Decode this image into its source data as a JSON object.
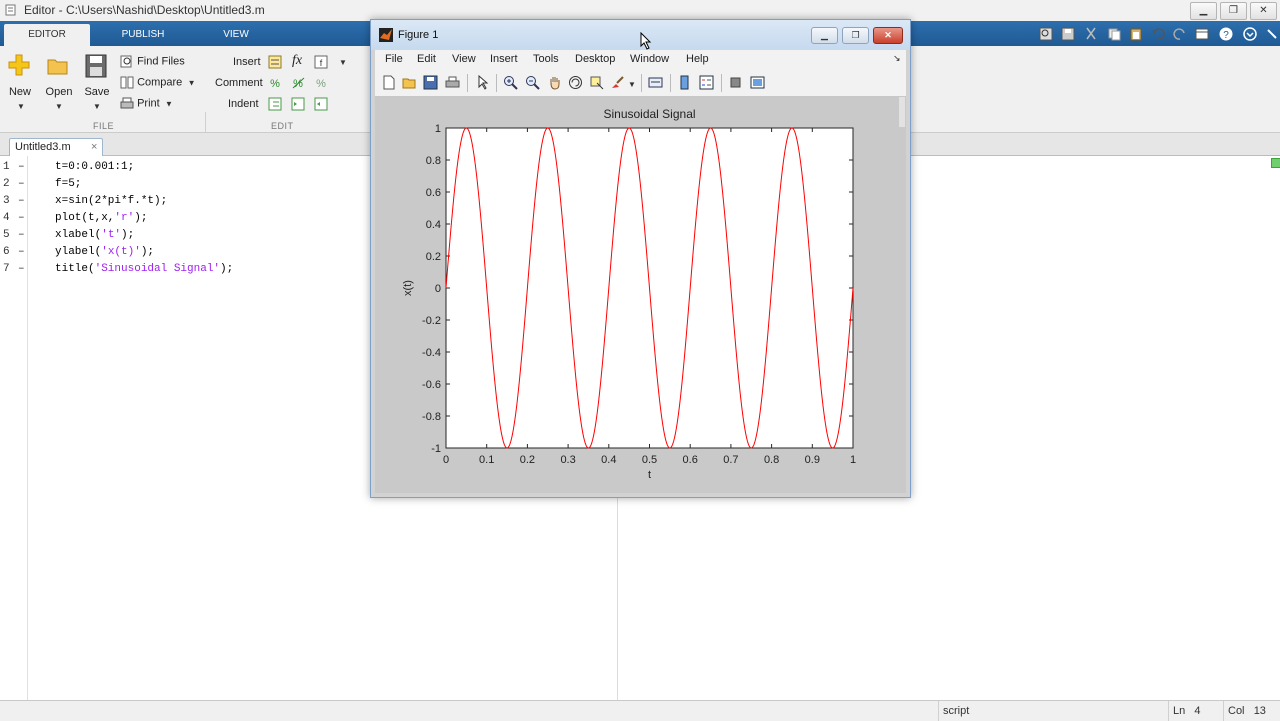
{
  "window": {
    "title": "Editor - C:\\Users\\Nashid\\Desktop\\Untitled3.m"
  },
  "ribbon": {
    "tabs": [
      "EDITOR",
      "PUBLISH",
      "VIEW"
    ],
    "file": {
      "new": "New",
      "open": "Open",
      "save": "Save",
      "find_files": "Find Files",
      "compare": "Compare",
      "print": "Print",
      "section_label": "FILE"
    },
    "edit": {
      "insert": "Insert",
      "fx": "fx",
      "comment": "Comment",
      "indent": "Indent",
      "section_label": "EDIT"
    }
  },
  "doc_tab": {
    "name": "Untitled3.m",
    "close": "×"
  },
  "editor": {
    "lines": [
      {
        "num": "1",
        "code": "t=0:0.001:1;",
        "str": ""
      },
      {
        "num": "2",
        "code": "f=5;",
        "str": ""
      },
      {
        "num": "3",
        "code": "x=sin(2*pi*f.*t);",
        "str": ""
      },
      {
        "num": "4",
        "code": "plot(t,x,",
        "str": "'r'",
        "tail": ");"
      },
      {
        "num": "5",
        "code": "xlabel(",
        "str": "'t'",
        "tail": ");"
      },
      {
        "num": "6",
        "code": "ylabel(",
        "str": "'x(t)'",
        "tail": ");"
      },
      {
        "num": "7",
        "code": "title(",
        "str": "'Sinusoidal Signal'",
        "tail": ");"
      }
    ],
    "dash": "–"
  },
  "status": {
    "mode": "script",
    "ln_label": "Ln",
    "ln_value": "4",
    "col_label": "Col",
    "col_value": "13"
  },
  "figure": {
    "title": "Figure 1",
    "menu": [
      "File",
      "Edit",
      "View",
      "Insert",
      "Tools",
      "Desktop",
      "Window",
      "Help"
    ]
  },
  "chart_data": {
    "type": "line",
    "title": "Sinusoidal Signal",
    "xlabel": "t",
    "ylabel": "x(t)",
    "xlim": [
      0,
      1
    ],
    "ylim": [
      -1,
      1
    ],
    "xticks": [
      "0",
      "0.1",
      "0.2",
      "0.3",
      "0.4",
      "0.5",
      "0.6",
      "0.7",
      "0.8",
      "0.9",
      "1"
    ],
    "yticks": [
      "-1",
      "-0.8",
      "-0.6",
      "-0.4",
      "-0.2",
      "0",
      "0.2",
      "0.4",
      "0.6",
      "0.8",
      "1"
    ],
    "series": [
      {
        "function": "sin(2*pi*f*t)",
        "frequency": 5,
        "step": 0.001,
        "color": "#ff0000"
      }
    ],
    "grid": false
  },
  "colors": {
    "ribbon": "#1f5a94",
    "string": "#a020f0",
    "plot_line": "#ff0000"
  }
}
